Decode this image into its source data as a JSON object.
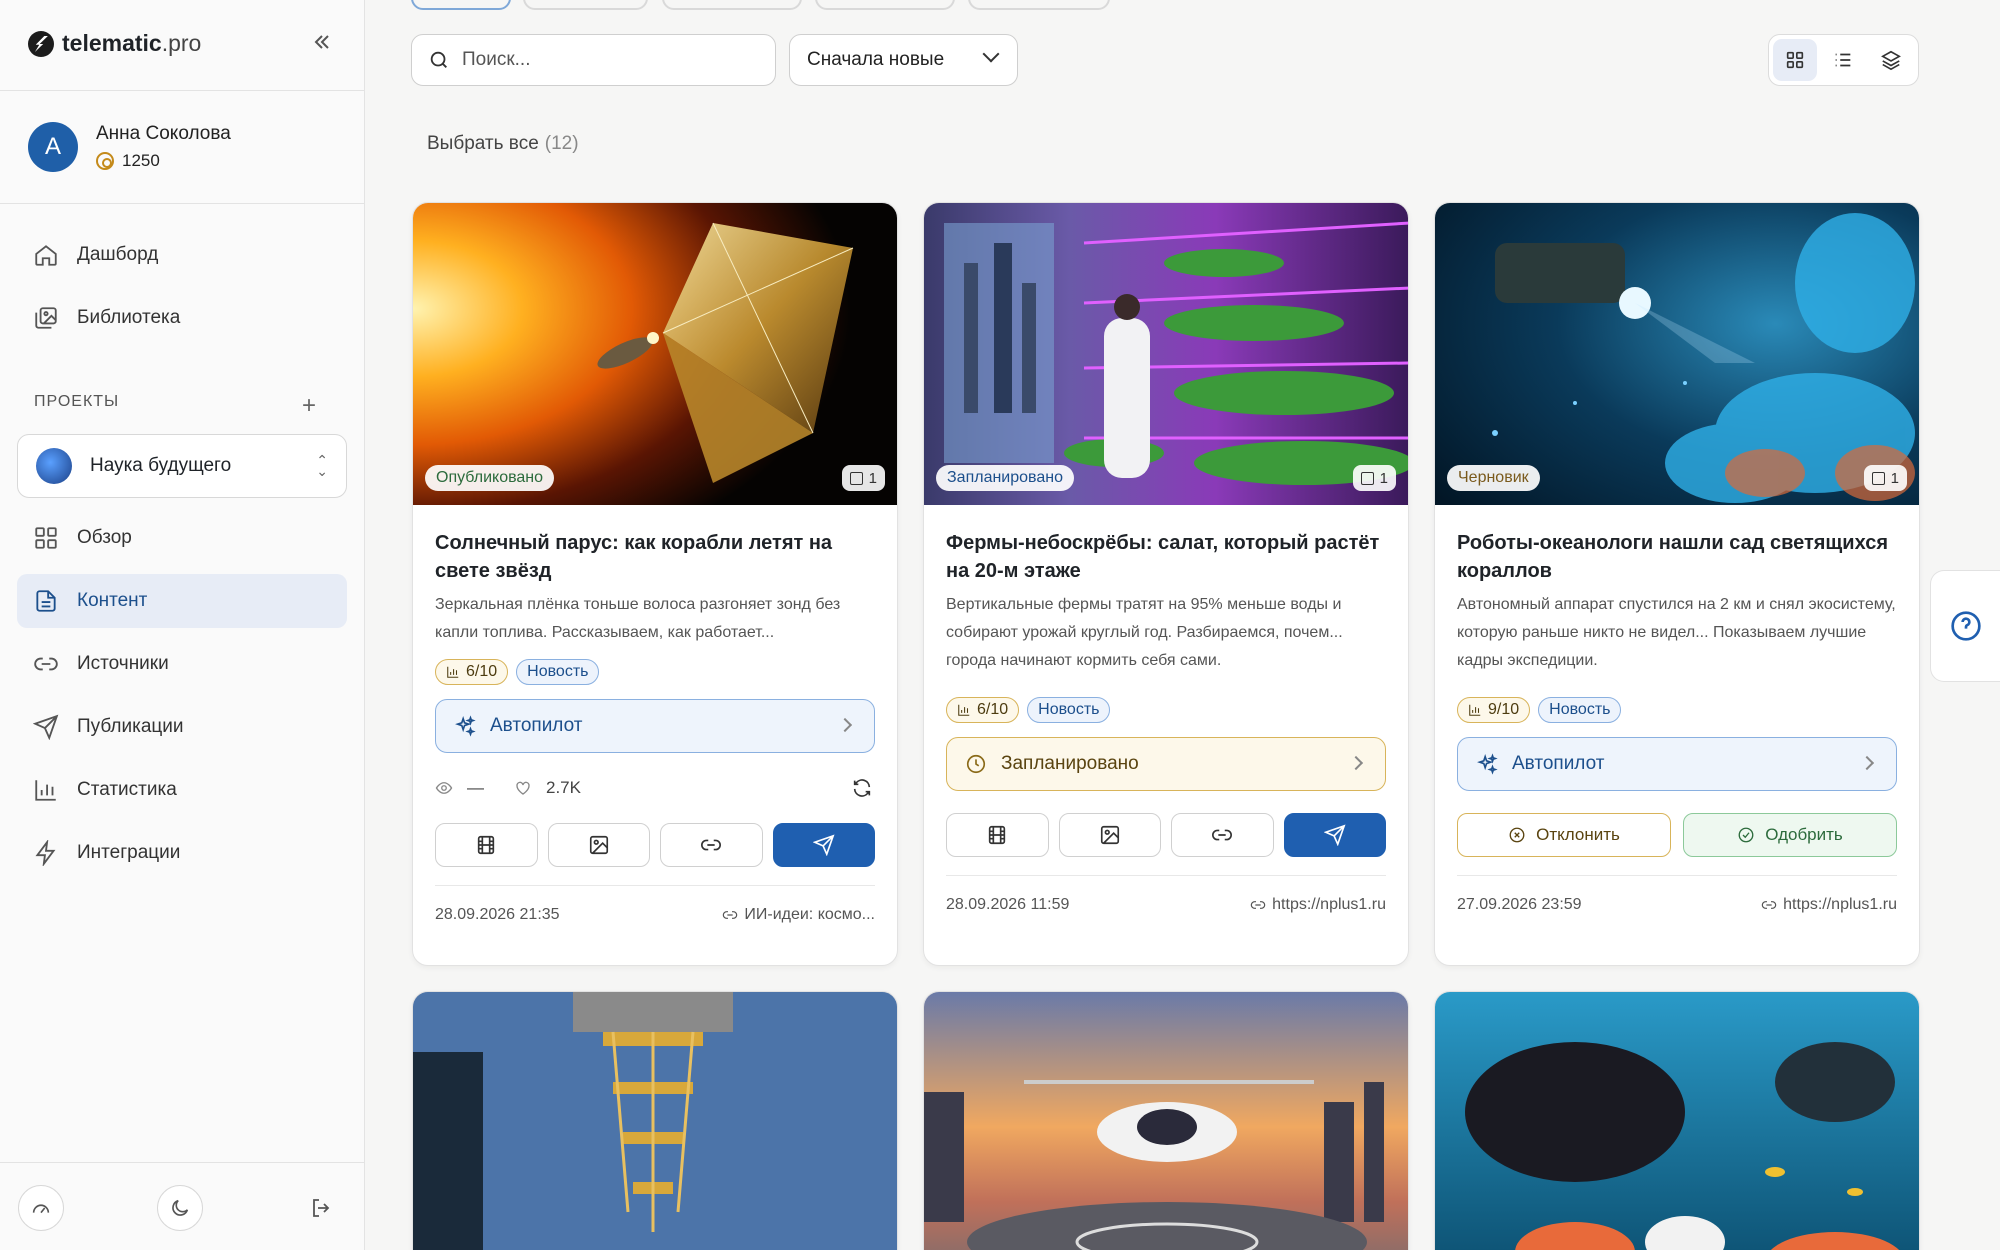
{
  "brand": {
    "name_bold": "telematic",
    "name_light": ".pro"
  },
  "user": {
    "initial": "A",
    "name": "Анна Соколова",
    "credits": "1250"
  },
  "nav_main": [
    {
      "label": "Дашборд",
      "icon": "home-icon"
    },
    {
      "label": "Библиотека",
      "icon": "library-icon"
    }
  ],
  "projects": {
    "section_label": "ПРОЕКТЫ",
    "add_icon": "plus-icon",
    "current": "Наука будущего"
  },
  "nav_project": [
    {
      "label": "Обзор",
      "icon": "grid-icon"
    },
    {
      "label": "Контент",
      "icon": "document-icon",
      "active": true
    },
    {
      "label": "Источники",
      "icon": "link-icon"
    },
    {
      "label": "Публикации",
      "icon": "send-icon"
    },
    {
      "label": "Статистика",
      "icon": "bar-chart-icon"
    },
    {
      "label": "Интеграции",
      "icon": "lightning-icon"
    }
  ],
  "toolbar": {
    "search_placeholder": "Поиск...",
    "sort_label": "Сначала новые",
    "view_modes": [
      "grid-view-icon",
      "list-view-icon",
      "layers-view-icon"
    ],
    "active_view": "grid-view-icon"
  },
  "select_all": {
    "label": "Выбрать все",
    "count": "(12)"
  },
  "cards": [
    {
      "status": "Опубликовано",
      "image_count": "1",
      "title": "Солнечный парус: как корабли летят на свете звёзд",
      "description": "Зеркальная плёнка тоньше волоса разгоняет зонд без капли топлива. Рассказываем, как работает...",
      "score": "6/10",
      "kind": "Новость",
      "action_label": "Автопилот",
      "views": "—",
      "likes": "2.7K",
      "date": "28.09.2026 21:35",
      "source": "ИИ-идеи: космо..."
    },
    {
      "status": "Запланировано",
      "image_count": "1",
      "title": "Фермы-небоскрёбы: салат, который растёт на 20-м этаже",
      "description": "Вертикальные фермы тратят на 95% меньше воды и собирают урожай круглый год. Разбираемся, почем... города начинают кормить себя сами.",
      "score": "6/10",
      "kind": "Новость",
      "action_label": "Запланировано",
      "date": "28.09.2026 11:59",
      "source": "https://nplus1.ru"
    },
    {
      "status": "Черновик",
      "image_count": "1",
      "title": "Роботы-океанологи нашли сад светящихся кораллов",
      "description": "Автономный аппарат спустился на 2 км и снял экосистему, которую раньше никто не видел... Показываем лучшие кадры экспедиции.",
      "score": "9/10",
      "kind": "Новость",
      "action_label": "Автопилот",
      "reject_label": "Отклонить",
      "approve_label": "Одобрить",
      "date": "27.09.2026 23:59",
      "source": "https://nplus1.ru"
    }
  ],
  "colors": {
    "accent": "#1f5fb0",
    "active_nav_bg": "#e7ecf6",
    "published": "#2c6b3c",
    "draft": "#7a5a1c"
  }
}
